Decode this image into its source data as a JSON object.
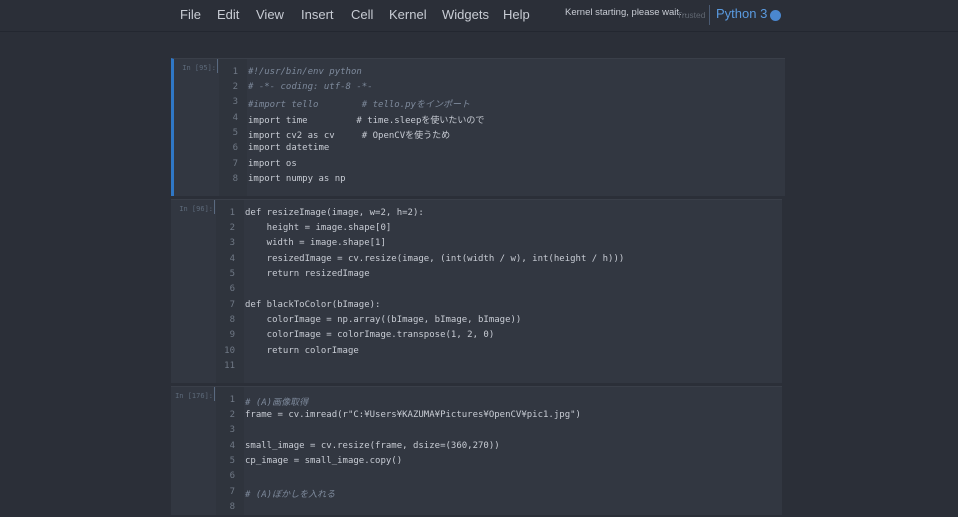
{
  "menu": [
    "File",
    "Edit",
    "View",
    "Insert",
    "Cell",
    "Kernel",
    "Widgets",
    "Help"
  ],
  "kernel": {
    "status": "Kernel starting, please wait...",
    "trusted": "Trusted",
    "name": "Python 3"
  },
  "cells": [
    {
      "prompt": "In [95]:",
      "lines": [
        "#!/usr/bin/env python",
        "# -*- coding: utf-8 -*-",
        "#import tello        # tello.pyをインポート",
        "import time         # time.sleepを使いたいので",
        "import cv2 as cv     # OpenCVを使うため",
        "import datetime",
        "import os",
        "import numpy as np"
      ]
    },
    {
      "prompt": "In [96]:",
      "lines": [
        "def resizeImage(image, w=2, h=2):",
        "    height = image.shape[0]",
        "    width = image.shape[1]",
        "    resizedImage = cv.resize(image, (int(width / w), int(height / h)))",
        "    return resizedImage",
        "",
        "def blackToColor(bImage):",
        "    colorImage = np.array((bImage, bImage, bImage))",
        "    colorImage = colorImage.transpose(1, 2, 0)",
        "    return colorImage",
        ""
      ]
    },
    {
      "prompt": "In [176]:",
      "lines": [
        "# (A)画像取得",
        "frame = cv.imread(r\"C:¥Users¥KAZUMA¥Pictures¥OpenCV¥pic1.jpg\")",
        "",
        "small_image = cv.resize(frame, dsize=(360,270))",
        "cp_image = small_image.copy()",
        "",
        "# (A)ぼかしを入れる",
        ""
      ]
    }
  ]
}
